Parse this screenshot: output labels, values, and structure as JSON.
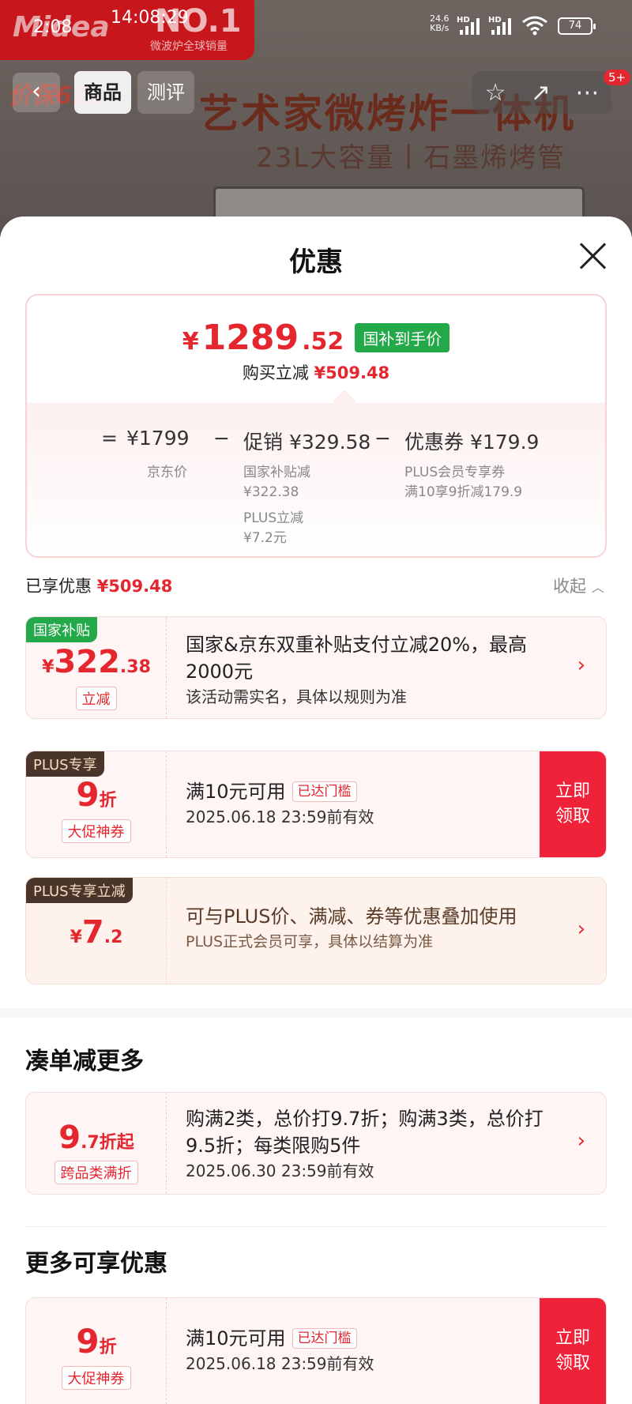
{
  "status_bar": {
    "time_left": "2:08",
    "time_center": "14:08:29",
    "net_speed": "24.6",
    "net_unit": "KB/s",
    "hd1": "HD",
    "hd2": "HD",
    "battery": "74",
    "wifi_icon": "wifi-icon"
  },
  "background_page": {
    "brand_logo": "Midea",
    "no1": "NO.1",
    "slogan": "微波炉全球销量",
    "promo": "价保618",
    "product_title": "艺术家微烤炸一体机",
    "product_subtitle": "23L大容量丨石墨烯烤管",
    "tabs": [
      "商品",
      "测评"
    ],
    "active_tab": "商品",
    "notification_badge": "5+"
  },
  "sheet": {
    "title": "优惠",
    "price": {
      "yen": "¥",
      "integer": "1289",
      "decimal": ".52",
      "tag": "国补到手价",
      "save_label": "购买立减",
      "save_value": "¥509.48"
    },
    "breakdown": {
      "eq": "=",
      "jd_price": "¥1799",
      "jd_label": "京东价",
      "minus1": "−",
      "promo": "促销 ¥329.58",
      "promo_note1": "国家补贴减",
      "promo_note1_val": "¥322.38",
      "promo_note2": "PLUS立减",
      "promo_note2_val": "¥7.2元",
      "minus2": "−",
      "coupon": "优惠券 ¥179.9",
      "coupon_note1": "PLUS会员专享券",
      "coupon_note2": "满10享9折减179.9"
    },
    "enjoyed_label": "已享优惠",
    "enjoyed_value": "¥509.48",
    "collapse_label": "收起",
    "coupons": [
      {
        "tag": "国家补贴",
        "yen": "¥",
        "amount": "322",
        "amount_dec": ".38",
        "pill": "立减",
        "headline": "国家&京东双重补贴支付立减20%，最高2000元",
        "desc": "该活动需实名，具体以规则为准"
      },
      {
        "tag": "PLUS专享",
        "amount": "9",
        "unit": "折",
        "pill": "大促神券",
        "headline": "满10元可用",
        "threshold": "已达门槛",
        "desc": "2025.06.18 23:59前有效",
        "claim": "立即领取"
      },
      {
        "tag": "PLUS专享立减",
        "yen": "¥",
        "amount": "7",
        "amount_dec": ".2",
        "headline": "可与PLUS价、满减、券等优惠叠加使用",
        "desc": "PLUS正式会员可享，具体以结算为准"
      }
    ],
    "section_more": "凑单减更多",
    "bundle": {
      "amount": "9",
      "amount_dec": ".7",
      "unit": "折起",
      "pill": "跨品类满折",
      "headline": "购满2类，总价打9.7折；购满3类，总价打9.5折；每类限购5件",
      "desc": "2025.06.30 23:59前有效"
    },
    "section_extra": "更多可享优惠",
    "extra_coupon": {
      "amount": "9",
      "unit": "折",
      "pill": "大促神券",
      "headline": "满10元可用",
      "threshold": "已达门槛",
      "desc": "2025.06.18 23:59前有效",
      "claim": "立即领取"
    }
  }
}
